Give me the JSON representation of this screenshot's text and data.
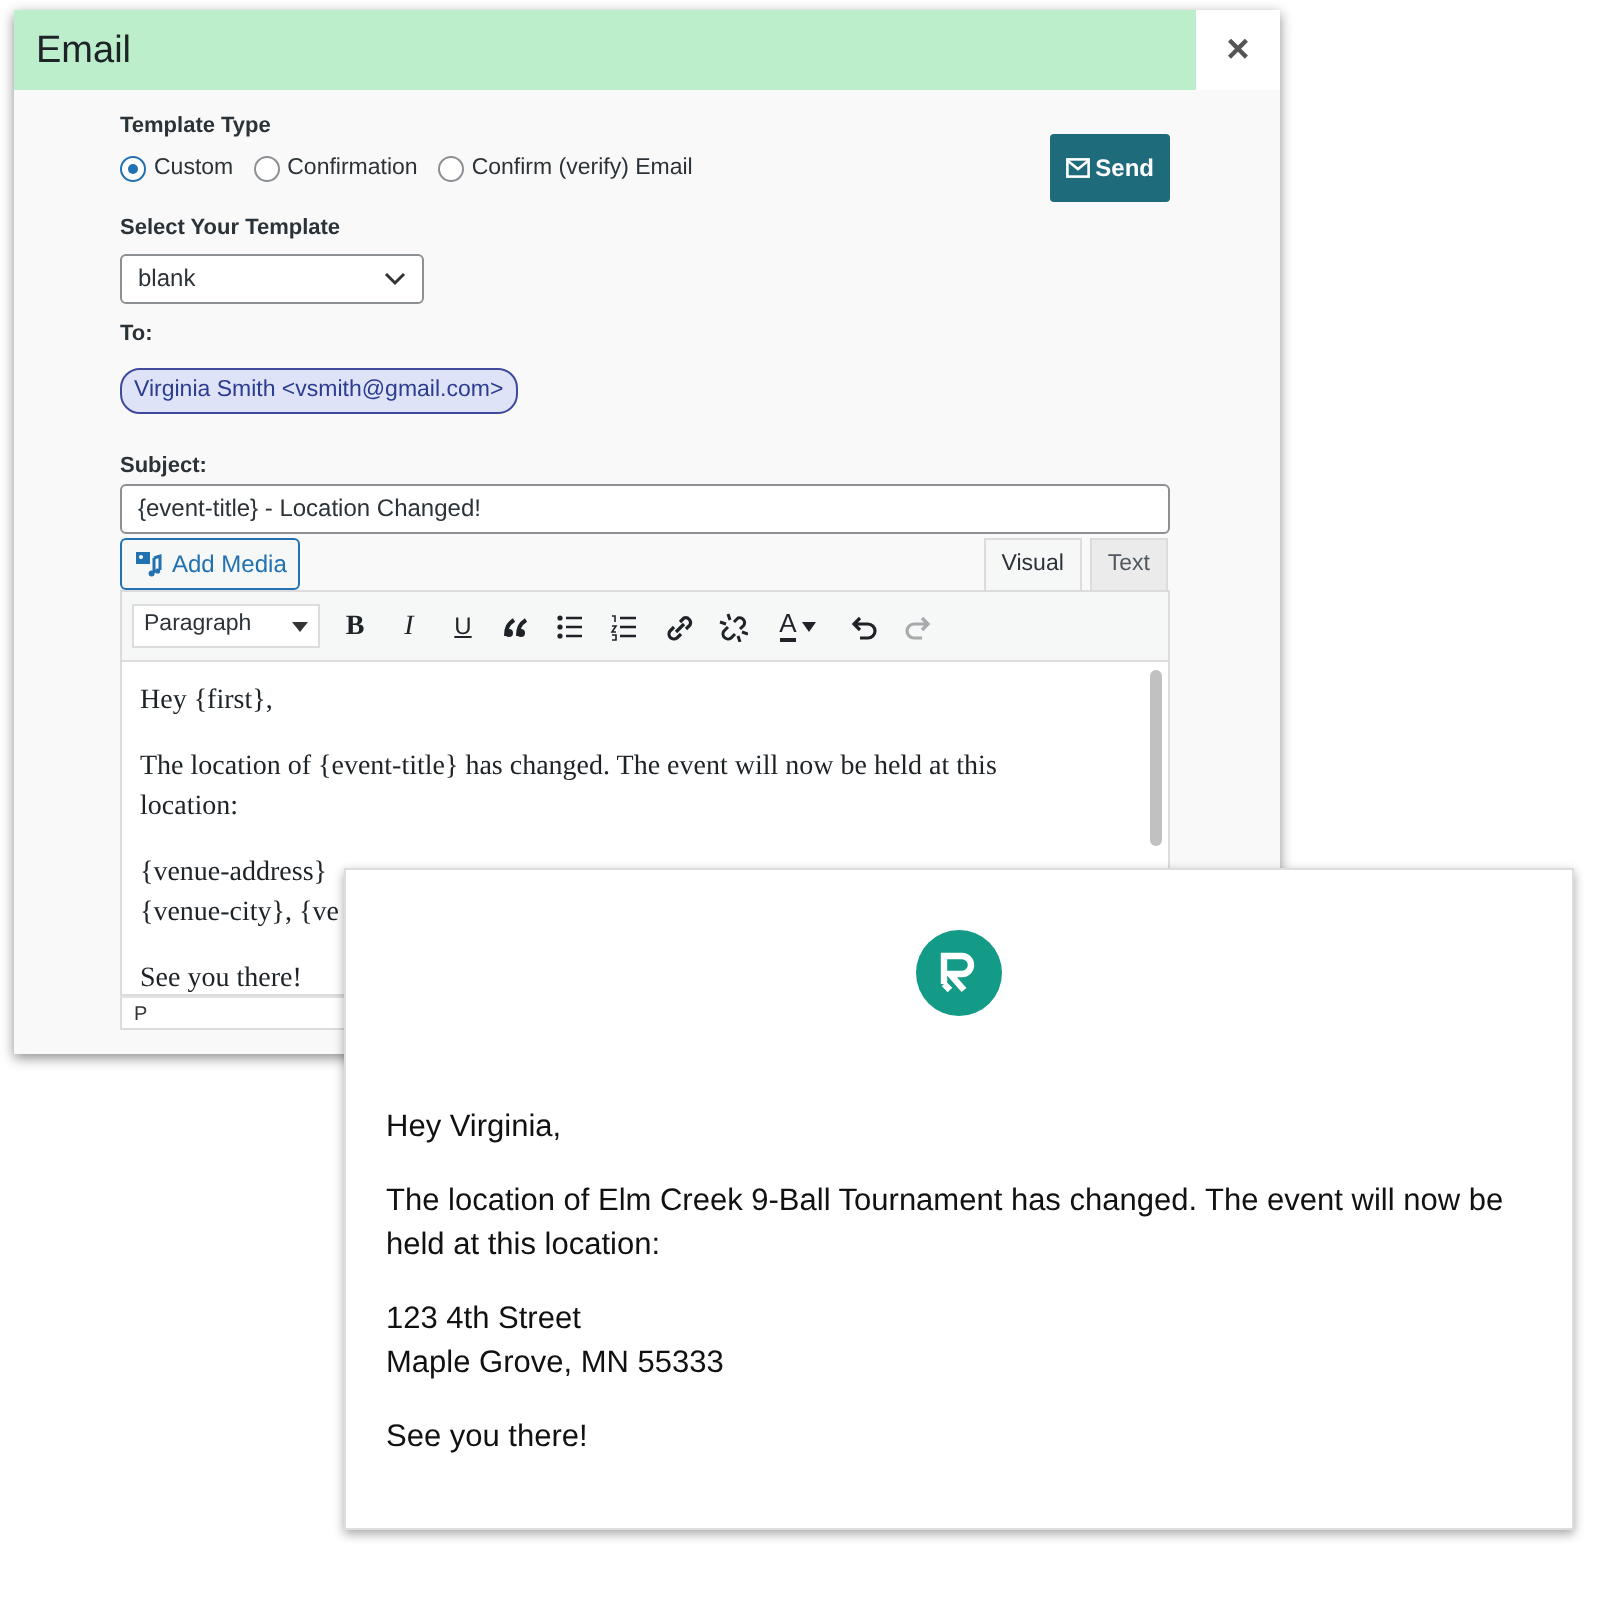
{
  "dialog": {
    "title": "Email",
    "close": "×",
    "template_type": {
      "label": "Template Type",
      "options": [
        {
          "label": "Custom",
          "selected": true
        },
        {
          "label": "Confirmation",
          "selected": false
        },
        {
          "label": "Confirm (verify) Email",
          "selected": false
        }
      ]
    },
    "send_button": "Send",
    "template_select": {
      "label": "Select Your Template",
      "value": "blank"
    },
    "to": {
      "label": "To:",
      "recipients": [
        "Virginia Smith <vsmith@gmail.com>"
      ]
    },
    "subject": {
      "label": "Subject:",
      "value": "{event-title} - Location Changed!"
    },
    "add_media": "Add Media",
    "editor_tabs": [
      {
        "label": "Visual",
        "selected": true
      },
      {
        "label": "Text",
        "selected": false
      }
    ],
    "format_select": "Paragraph",
    "toolbar": [
      {
        "kind": "bold",
        "text": "B",
        "disabled": false
      },
      {
        "kind": "italic",
        "text": "I",
        "disabled": false
      },
      {
        "kind": "underline",
        "text": "U",
        "disabled": false
      },
      {
        "kind": "quote",
        "disabled": false
      },
      {
        "kind": "bullets",
        "disabled": false
      },
      {
        "kind": "numbers",
        "disabled": false
      },
      {
        "kind": "link",
        "disabled": false
      },
      {
        "kind": "unlink",
        "disabled": false
      },
      {
        "kind": "color",
        "text": "A",
        "disabled": false
      },
      {
        "kind": "undo",
        "disabled": false
      },
      {
        "kind": "redo",
        "disabled": true
      }
    ],
    "body": [
      [
        "Hey {first},"
      ],
      [
        "The location of {event-title} has changed. The event will now be held at this location:"
      ],
      [
        "{venue-address}",
        "{venue-city}, {ve"
      ],
      [
        "See you there!"
      ]
    ],
    "status_path": "P"
  },
  "preview": {
    "body": [
      [
        "Hey Virginia,"
      ],
      [
        "The location of Elm Creek 9-Ball Tournament has changed. The event will now be held at this location:"
      ],
      [
        "123 4th Street",
        "Maple Grove, MN 55333"
      ],
      [
        "See you there!"
      ]
    ]
  }
}
